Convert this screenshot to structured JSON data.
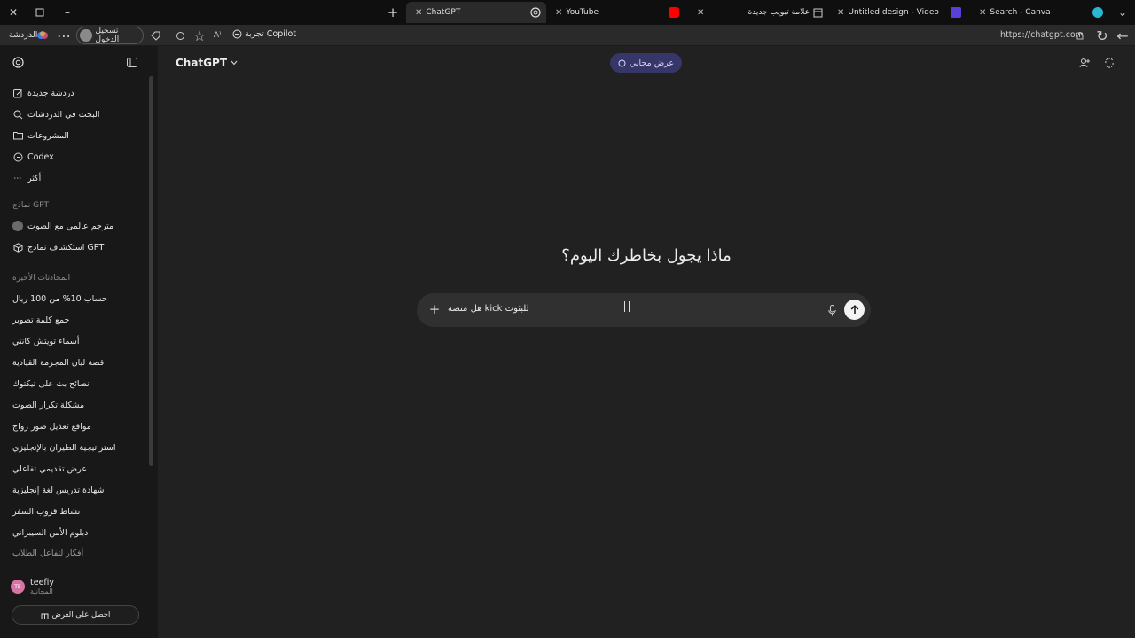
{
  "browser": {
    "tabs": [
      {
        "label": "ChatGPT",
        "active": true
      },
      {
        "label": "YouTube",
        "active": false
      },
      {
        "label": "علامة تبويب جديدة",
        "active": false
      },
      {
        "label": "Untitled design - Video",
        "active": false
      },
      {
        "label": "Search - Canva",
        "active": false
      }
    ],
    "address": {
      "url": "https://chatgpt.com",
      "chat_label": "الدردشة",
      "signin_label": "تسجيل الدخول",
      "copilot_label": "تجربة Copilot"
    }
  },
  "sidebar": {
    "actions": [
      {
        "label": "دردشة جديدة",
        "icon": "pencil-square-icon"
      },
      {
        "label": "البحث في الدردشات",
        "icon": "search-icon"
      },
      {
        "label": "المشروعات",
        "icon": "folder-icon"
      },
      {
        "label": "Codex",
        "icon": "codex-icon"
      },
      {
        "label": "أكثر",
        "icon": "more-dots-icon"
      }
    ],
    "gpts_heading": "نماذج GPT",
    "gpts": [
      {
        "label": "مترجم عالمي مع الصوت",
        "icon": "translator-avatar-icon"
      },
      {
        "label": "استكشاف نماذج GPT",
        "icon": "cube-icon"
      }
    ],
    "recent_heading": "المحادثات الأخيرة",
    "recent": [
      "حساب 10% من 100 ريال",
      "جمع كلمة تصوير",
      "أسماء تويتش كانتي",
      "قصة ليان المجرمة القيادية",
      "نصائح بث على تيكتوك",
      "مشكلة تكرار الصوت",
      "مواقع تعديل صور زواج",
      "استراتيجية الطيران بالإنجليزي",
      "عرض تقديمي تفاعلي",
      "شهادة تدريس لغة إنجليزية",
      "نشاط قروب السفر",
      "دبلوم الأمن السيبراني",
      "أفكار لتفاعل الطلاب"
    ],
    "user": {
      "initials": "TE",
      "name": "teefiy",
      "plan": "المجانية"
    },
    "offer_button": "احصل على العرض"
  },
  "main": {
    "model_name": "ChatGPT",
    "free_offer": "عرض مجاني",
    "greeting": "ماذا يجول بخاطرك اليوم؟",
    "composer": {
      "value": "هل منصة kick للبثوث"
    }
  },
  "colors": {
    "accent_offer": "#373669",
    "sidebar_bg": "#181818",
    "main_bg": "#212121"
  }
}
